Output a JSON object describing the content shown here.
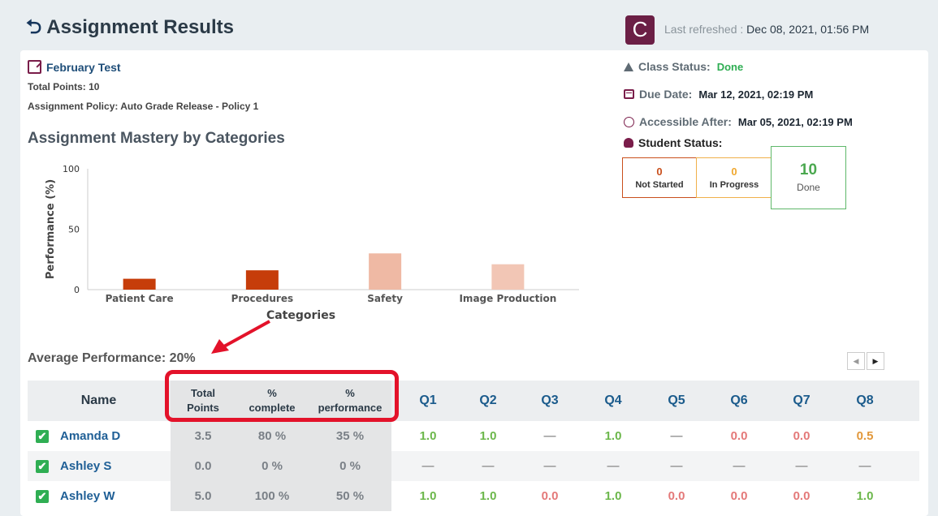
{
  "header": {
    "title": "Assignment Results",
    "refresh_label": "Last refreshed :",
    "refresh_time": "Dec 08, 2021, 01:56 PM"
  },
  "assignment": {
    "name": "February Test",
    "total_points": "Total Points: 10",
    "policy": "Assignment Policy: Auto Grade Release - Policy 1"
  },
  "mastery_title": "Assignment Mastery by Categories",
  "chart_data": {
    "type": "bar",
    "categories": [
      "Patient Care",
      "Procedures",
      "Safety",
      "Image Production"
    ],
    "values": [
      9,
      16,
      30,
      21
    ],
    "xlabel": "Categories",
    "ylabel": "Performance (%)",
    "ylim": [
      0,
      100
    ],
    "yticks": [
      "0",
      "50",
      "100"
    ],
    "colors": [
      "#c63d0a",
      "#c63d0a",
      "#efb9a4",
      "#f2c6b5"
    ]
  },
  "status": {
    "class_label": "Class Status:",
    "class_value": "Done",
    "due_label": "Due Date:",
    "due_value": "Mar 12, 2021, 02:19 PM",
    "access_label": "Accessible After:",
    "access_value": "Mar 05, 2021, 02:19 PM",
    "student_label": "Student Status:",
    "not_started_count": "0",
    "not_started_label": "Not Started",
    "in_progress_count": "0",
    "in_progress_label": "In Progress",
    "done_count": "10",
    "done_label": "Done"
  },
  "average": "Average Performance: 20%",
  "table": {
    "headers": {
      "name": "Name",
      "total": [
        "Total",
        "Points"
      ],
      "complete": [
        "%",
        "complete"
      ],
      "performance": [
        "%",
        "performance"
      ],
      "q": [
        "Q1",
        "Q2",
        "Q3",
        "Q4",
        "Q5",
        "Q6",
        "Q7",
        "Q8"
      ]
    },
    "rows": [
      {
        "name": "Amanda D",
        "total": "3.5",
        "complete": "80 %",
        "performance": "35 %",
        "q": [
          "1.0",
          "1.0",
          "—",
          "1.0",
          "—",
          "0.0",
          "0.0",
          "0.5"
        ]
      },
      {
        "name": "Ashley S",
        "total": "0.0",
        "complete": "0 %",
        "performance": "0 %",
        "q": [
          "—",
          "—",
          "—",
          "—",
          "—",
          "—",
          "—",
          "—"
        ]
      },
      {
        "name": "Ashley W",
        "total": "5.0",
        "complete": "100 %",
        "performance": "50 %",
        "q": [
          "1.0",
          "1.0",
          "0.0",
          "1.0",
          "0.0",
          "0.0",
          "0.0",
          "1.0"
        ]
      }
    ]
  },
  "pager": {
    "prev": "◀",
    "next": "▶"
  }
}
